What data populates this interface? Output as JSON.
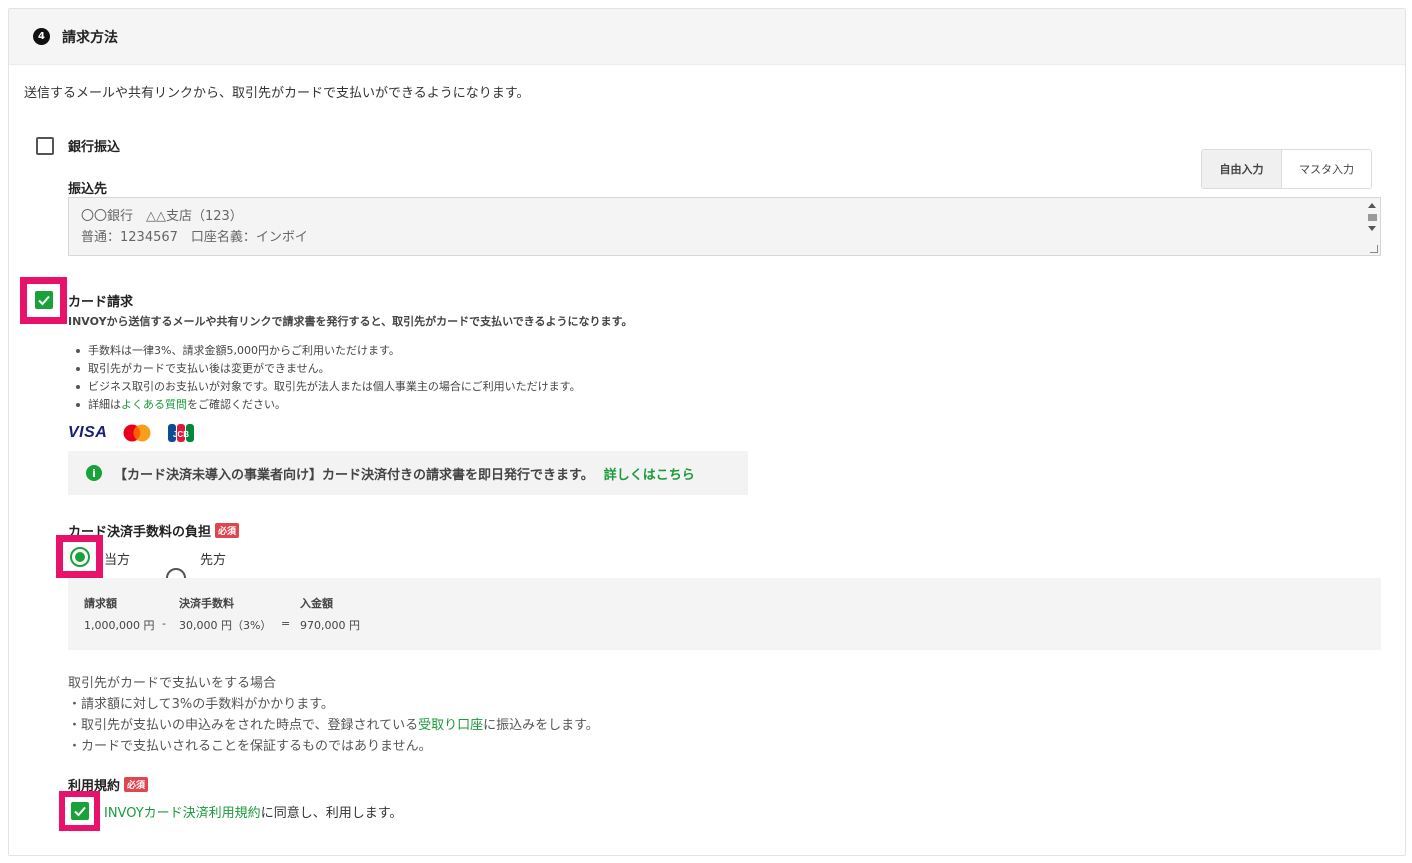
{
  "section": {
    "step": "4",
    "title": "請求方法",
    "intro": "送信するメールや共有リンクから、取引先がカードで支払いができるようになります。"
  },
  "bank": {
    "checkbox_label": "銀行振込",
    "checked": false,
    "dest_label": "振込先",
    "mode_free": "自由入力",
    "mode_master": "マスタ入力",
    "textarea_line1": "〇〇銀行　△△支店（123）",
    "textarea_line2": "普通：1234567　口座名義：インボイ"
  },
  "card": {
    "checkbox_label": "カード請求",
    "checked": true,
    "description": "INVOYから送信するメールや共有リンクで請求書を発行すると、取引先がカードで支払いできるようになります。",
    "bullets": [
      "手数料は一律3%、請求金額5,000円からご利用いただけます。",
      "取引先がカードで支払い後は変更ができません。",
      "ビジネス取引のお支払いが対象です。取引先が法人または個人事業主の場合にご利用いただけます。"
    ],
    "bullet4_pre": "詳細は",
    "bullet4_link": "よくある質問",
    "bullet4_post": "をご確認ください。",
    "brands": {
      "visa": "VISA",
      "jcb": "JCB"
    },
    "notice_text": "【カード決済未導入の事業者向け】カード決済付きの請求書を即日発行できます。",
    "notice_link": "詳しくはこちら"
  },
  "fee": {
    "label": "カード決済手数料の負担",
    "required": "必須",
    "option_self": "当方",
    "option_other": "先方",
    "selected": "当方",
    "col_amount": "請求額",
    "col_fee": "決済手数料",
    "col_deposit": "入金額",
    "amount": "1,000,000 円",
    "minus": "-",
    "fee_value": "30,000 円（3%）",
    "equals": "=",
    "deposit": "970,000 円"
  },
  "notes": {
    "heading": "取引先がカードで支払いをする場合",
    "line1": "・請求額に対して3%の手数料がかかります。",
    "line2_pre": "・取引先が支払いの申込みをされた時点で、登録されている",
    "line2_link": "受取り口座",
    "line2_post": "に振込みをします。",
    "line3": "・カードで支払いされることを保証するものではありません。"
  },
  "terms": {
    "label": "利用規約",
    "required": "必須",
    "link": "INVOYカード決済利用規約",
    "text": "に同意し、利用します。",
    "checked": true
  },
  "colors": {
    "accent_green": "#1aa23a",
    "highlight_pink": "#e8126a",
    "required_red": "#e0464f"
  }
}
